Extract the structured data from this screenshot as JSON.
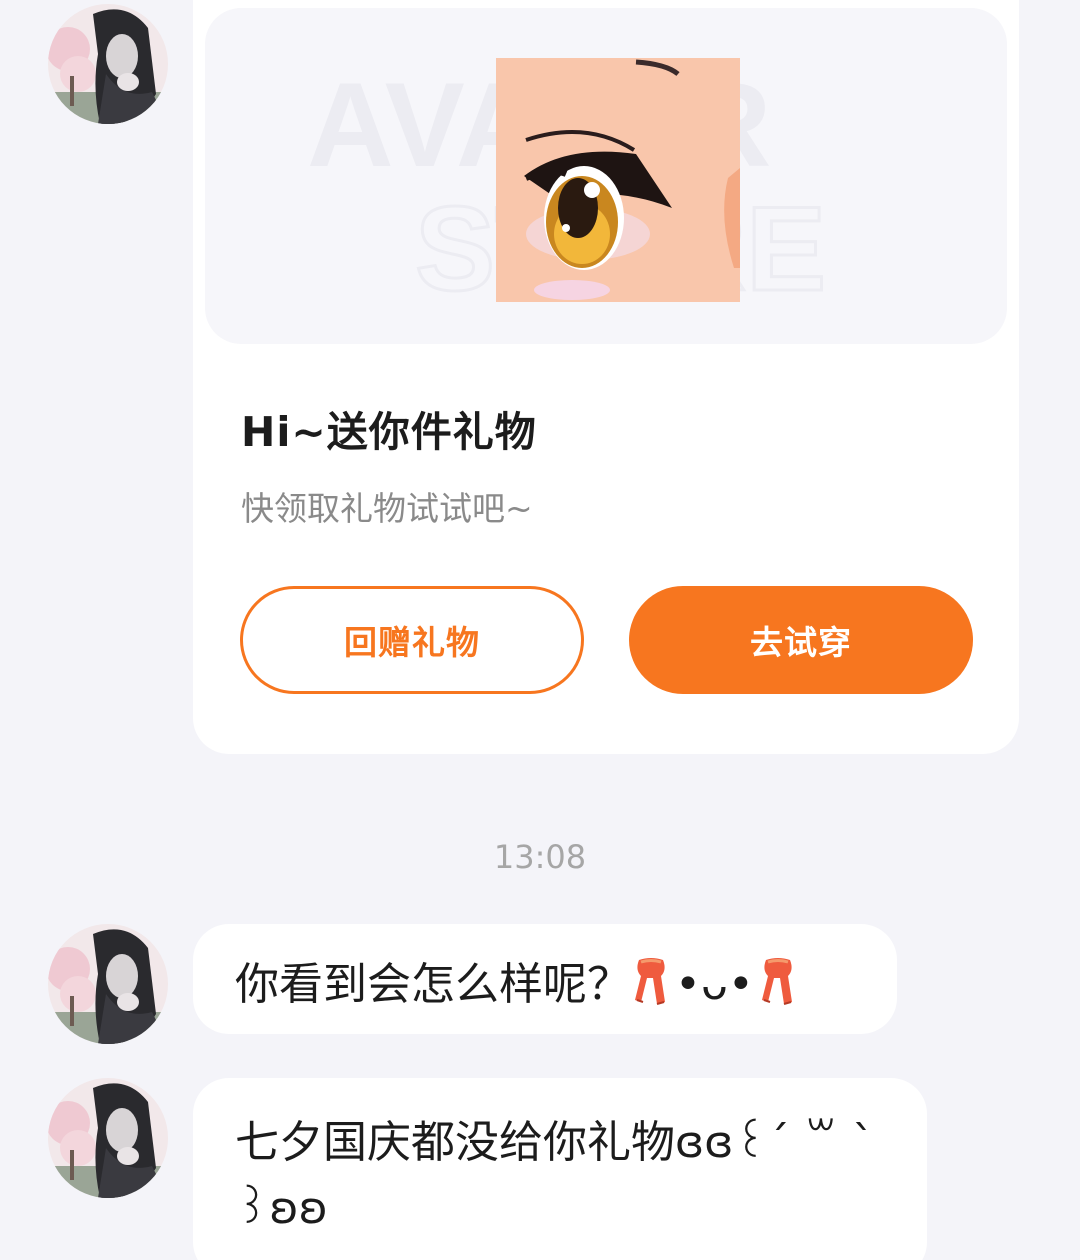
{
  "gift_card": {
    "banner_watermark_line1": "AVATAR",
    "banner_watermark_line2": "STORE",
    "title": "Hi~送你件礼物",
    "subtitle": "快领取礼物试试吧~",
    "return_gift_button": "回赠礼物",
    "try_on_button": "去试穿"
  },
  "timestamp": "13:08",
  "messages": [
    {
      "text": "你看到会怎么样呢？",
      "kaomoji": "•ᴗ•",
      "emoji": "scarf-icon"
    },
    {
      "text": "七夕国庆都没给你礼物ɞɞ꒰ˊ ꒳ ˋ ꒱ʚʚ"
    }
  ],
  "colors": {
    "accent": "#f7761f",
    "page_bg": "#f4f4f9",
    "card_bg": "#ffffff"
  }
}
